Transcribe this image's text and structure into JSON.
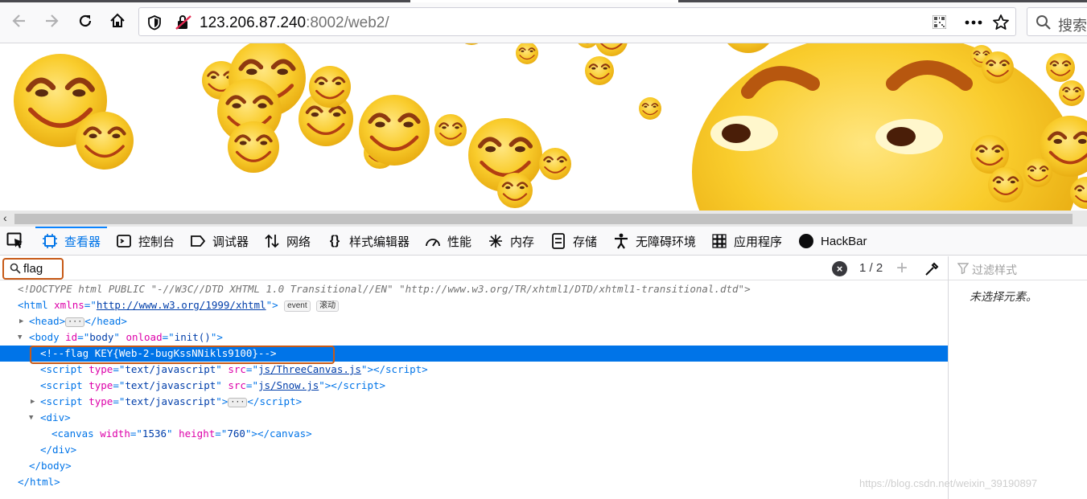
{
  "browser": {
    "url_host": "123.206.87.240",
    "url_rest": ":8002/web2/",
    "search_placeholder": "搜索"
  },
  "devtools": {
    "tabs": [
      {
        "label": "查看器",
        "icon": "inspector-icon"
      },
      {
        "label": "控制台",
        "icon": "console-icon"
      },
      {
        "label": "调试器",
        "icon": "debugger-icon"
      },
      {
        "label": "网络",
        "icon": "network-icon"
      },
      {
        "label": "样式编辑器",
        "icon": "style-editor-icon"
      },
      {
        "label": "性能",
        "icon": "performance-icon"
      },
      {
        "label": "内存",
        "icon": "memory-icon"
      },
      {
        "label": "存储",
        "icon": "storage-icon"
      },
      {
        "label": "无障碍环境",
        "icon": "accessibility-icon"
      },
      {
        "label": "应用程序",
        "icon": "application-icon"
      },
      {
        "label": "HackBar",
        "icon": "hackbar-icon"
      }
    ],
    "search": {
      "query": "flag",
      "match_count": "1 / 2"
    },
    "sidebar": {
      "filter_placeholder": "过滤样式",
      "empty_message": "未选择元素。"
    },
    "markup": {
      "doctype": "<!DOCTYPE html PUBLIC \"-//W3C//DTD XHTML 1.0 Transitional//EN\" \"http://www.w3.org/TR/xhtml1/DTD/xhtml1-transitional.dtd\">",
      "html_xmlns": "http://www.w3.org/1999/xhtml",
      "badge_event": "event",
      "badge_scroll": "滚动",
      "body_id": "body",
      "body_onload": "init()",
      "comment": "<!--flag KEY{Web-2-bugKssNNikls9100}-->",
      "script_type": "text/javascript",
      "script1_src": "js/ThreeCanvas.js",
      "script2_src": "js/Snow.js",
      "canvas_width": "1536",
      "canvas_height": "760"
    }
  },
  "watermark": "https://blog.csdn.net/weixin_39190897"
}
